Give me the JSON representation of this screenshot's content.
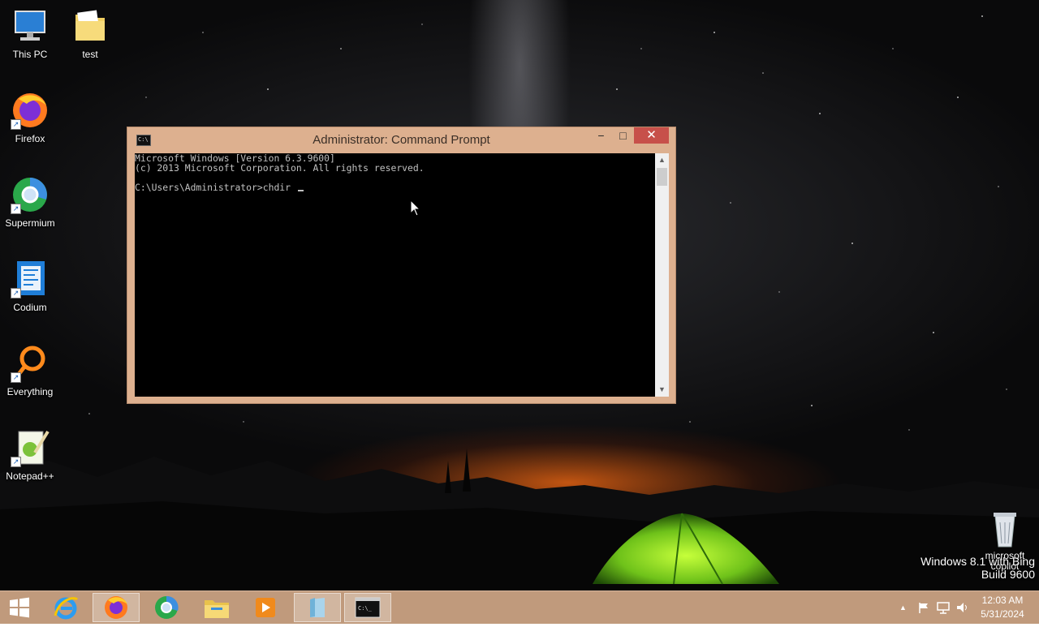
{
  "desktop": {
    "icons": [
      {
        "label": "This PC",
        "icon": "computer-icon"
      },
      {
        "label": "test",
        "icon": "folder-icon"
      },
      {
        "label": "Firefox",
        "icon": "firefox-icon"
      },
      {
        "label": "Supermium",
        "icon": "supermium-icon"
      },
      {
        "label": "Codium",
        "icon": "codium-icon"
      },
      {
        "label": "Everything",
        "icon": "everything-icon"
      },
      {
        "label": "Notepad++",
        "icon": "notepadpp-icon"
      }
    ],
    "recycle_bin_label": "microsoft copilot",
    "watermark": {
      "line1": "Windows 8.1 with Bing",
      "line2": "Build 9600"
    }
  },
  "window": {
    "title": "Administrator: Command Prompt",
    "icon_text": "C:\\",
    "buttons": {
      "minimize": "−",
      "maximize": "□",
      "close": "✕"
    },
    "console_lines": [
      "Microsoft Windows [Version 6.3.9600]",
      "(c) 2013 Microsoft Corporation. All rights reserved.",
      "",
      "C:\\Users\\Administrator>chdir "
    ],
    "scroll_up": "▲",
    "scroll_down": "▼"
  },
  "taskbar": {
    "items": [
      {
        "name": "start-button",
        "icon": "windows-logo-icon"
      },
      {
        "name": "internet-explorer",
        "icon": "ie-icon"
      },
      {
        "name": "firefox",
        "icon": "firefox-icon"
      },
      {
        "name": "supermium",
        "icon": "supermium-icon"
      },
      {
        "name": "file-explorer",
        "icon": "folder-icon"
      },
      {
        "name": "media-player",
        "icon": "media-player-icon"
      },
      {
        "name": "notebook-app",
        "icon": "notebook-icon"
      },
      {
        "name": "command-prompt",
        "icon": "cmd-icon"
      }
    ],
    "tray": {
      "expand": "▲"
    },
    "clock": {
      "time": "12:03 AM",
      "date": "5/31/2024"
    }
  },
  "colors": {
    "window_frame": "#ddb08f",
    "taskbar": "#c09a7c",
    "close_red": "#c7504a"
  }
}
